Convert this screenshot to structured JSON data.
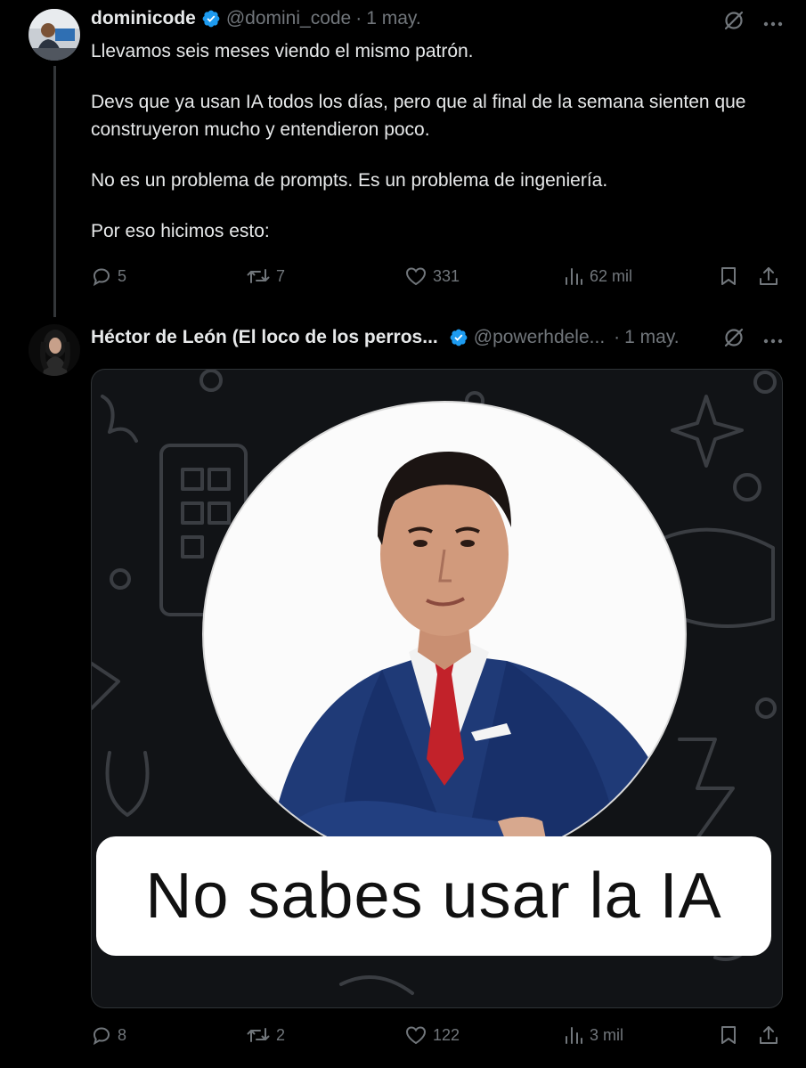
{
  "colors": {
    "background": "#000000",
    "text_primary": "#e7e9ea",
    "text_secondary": "#71767b",
    "verified_blue": "#1d9bf0"
  },
  "tweets": [
    {
      "name": "dominicode",
      "handle": "@domini_code",
      "separator": "·",
      "date": "1 may.",
      "paragraphs": [
        "Llevamos seis meses viendo el mismo patrón.",
        "Devs que ya usan IA todos los días, pero que al final de la semana sienten que construyeron mucho y entendieron poco.",
        "No es un problema de prompts. Es un problema de ingeniería.",
        "Por eso hicimos esto:"
      ],
      "stats": {
        "replies": "5",
        "reposts": "7",
        "likes": "331",
        "views": "62 mil"
      }
    },
    {
      "name": "Héctor de León (El loco de los perros...",
      "handle": "@powerhdele...",
      "separator": "·",
      "date": "1 may.",
      "media_caption": "No sabes usar la IA",
      "stats": {
        "replies": "8",
        "reposts": "2",
        "likes": "122",
        "views": "3 mil"
      }
    }
  ],
  "icons": [
    "grok-icon",
    "more-icon",
    "reply-icon",
    "repost-icon",
    "like-icon",
    "views-icon",
    "bookmark-icon",
    "share-icon",
    "verified-badge-icon"
  ]
}
